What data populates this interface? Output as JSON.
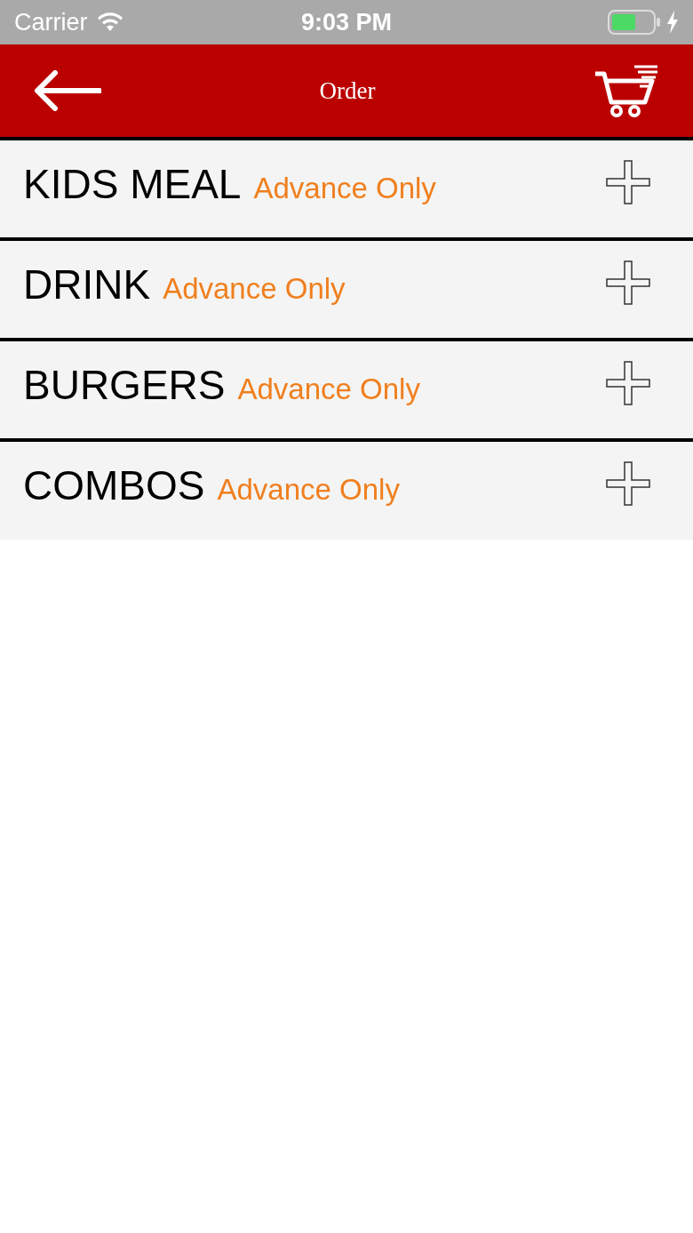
{
  "status_bar": {
    "carrier": "Carrier",
    "time": "9:03 PM"
  },
  "header": {
    "title": "Order"
  },
  "categories": [
    {
      "name": "KIDS MEAL",
      "note": "Advance Only"
    },
    {
      "name": "DRINK",
      "note": "Advance Only"
    },
    {
      "name": "BURGERS",
      "note": "Advance Only"
    },
    {
      "name": "COMBOS",
      "note": "Advance Only"
    }
  ]
}
